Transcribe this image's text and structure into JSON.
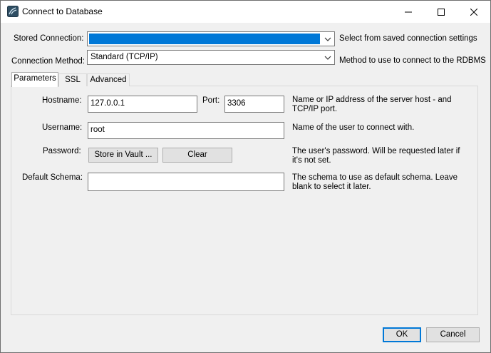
{
  "window": {
    "title": "Connect to Database",
    "icons": {
      "app": "mysql-workbench-icon",
      "minimize": "minimize-icon",
      "maximize": "maximize-icon",
      "close": "close-icon"
    }
  },
  "header": {
    "stored_connection": {
      "label": "Stored Connection:",
      "value": "",
      "help": "Select from saved connection settings"
    },
    "connection_method": {
      "label": "Connection Method:",
      "value": "Standard (TCP/IP)",
      "help": "Method to use to connect to the RDBMS"
    }
  },
  "tabs": [
    {
      "label": "Parameters",
      "active": true
    },
    {
      "label": "SSL",
      "active": false
    },
    {
      "label": "Advanced",
      "active": false
    }
  ],
  "params": {
    "hostname": {
      "label": "Hostname:",
      "value": "127.0.0.1"
    },
    "port": {
      "label": "Port:",
      "value": "3306"
    },
    "host_help": "Name or IP address of the server host - and TCP/IP port.",
    "username": {
      "label": "Username:",
      "value": "root",
      "help": "Name of the user to connect with."
    },
    "password": {
      "label": "Password:",
      "store_button": "Store in Vault ...",
      "clear_button": "Clear",
      "help": "The user's password. Will be requested later if it's not set."
    },
    "default_schema": {
      "label": "Default Schema:",
      "value": "",
      "help": "The schema to use as default schema. Leave blank to select it later."
    }
  },
  "footer": {
    "ok": "OK",
    "cancel": "Cancel"
  },
  "colors": {
    "accent": "#0078d7",
    "window_bg": "#f0f0f0"
  }
}
